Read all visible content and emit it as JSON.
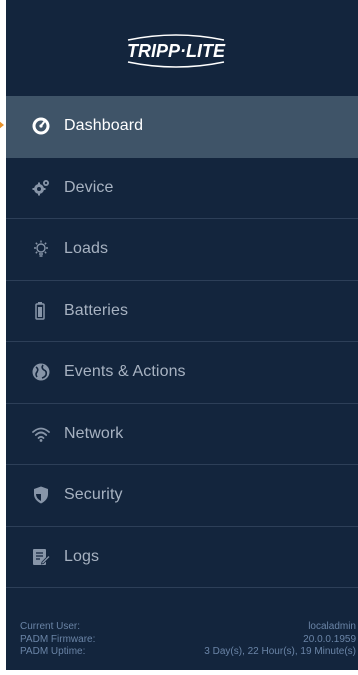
{
  "brand": {
    "logo_text": "TRIPP·LITE",
    "accent_color": "#e8922a",
    "sidebar_bg": "#13253d",
    "active_bg": "#3f5468"
  },
  "menu": {
    "active": "Dashboard",
    "items": [
      {
        "label": "Dashboard",
        "icon": "speedometer-icon"
      },
      {
        "label": "Device",
        "icon": "gears-icon"
      },
      {
        "label": "Loads",
        "icon": "lightbulb-icon"
      },
      {
        "label": "Batteries",
        "icon": "battery-icon"
      },
      {
        "label": "Events & Actions",
        "icon": "globe-icon"
      },
      {
        "label": "Network",
        "icon": "wifi-icon"
      },
      {
        "label": "Security",
        "icon": "shield-icon"
      },
      {
        "label": "Logs",
        "icon": "log-document-icon"
      }
    ]
  },
  "status": {
    "current_user_label": "Current User:",
    "current_user_value": "localadmin",
    "firmware_label": "PADM Firmware:",
    "firmware_value": "20.0.0.1959",
    "uptime_label": "PADM Uptime:",
    "uptime_value": "3 Day(s), 22 Hour(s), 19 Minute(s)"
  }
}
